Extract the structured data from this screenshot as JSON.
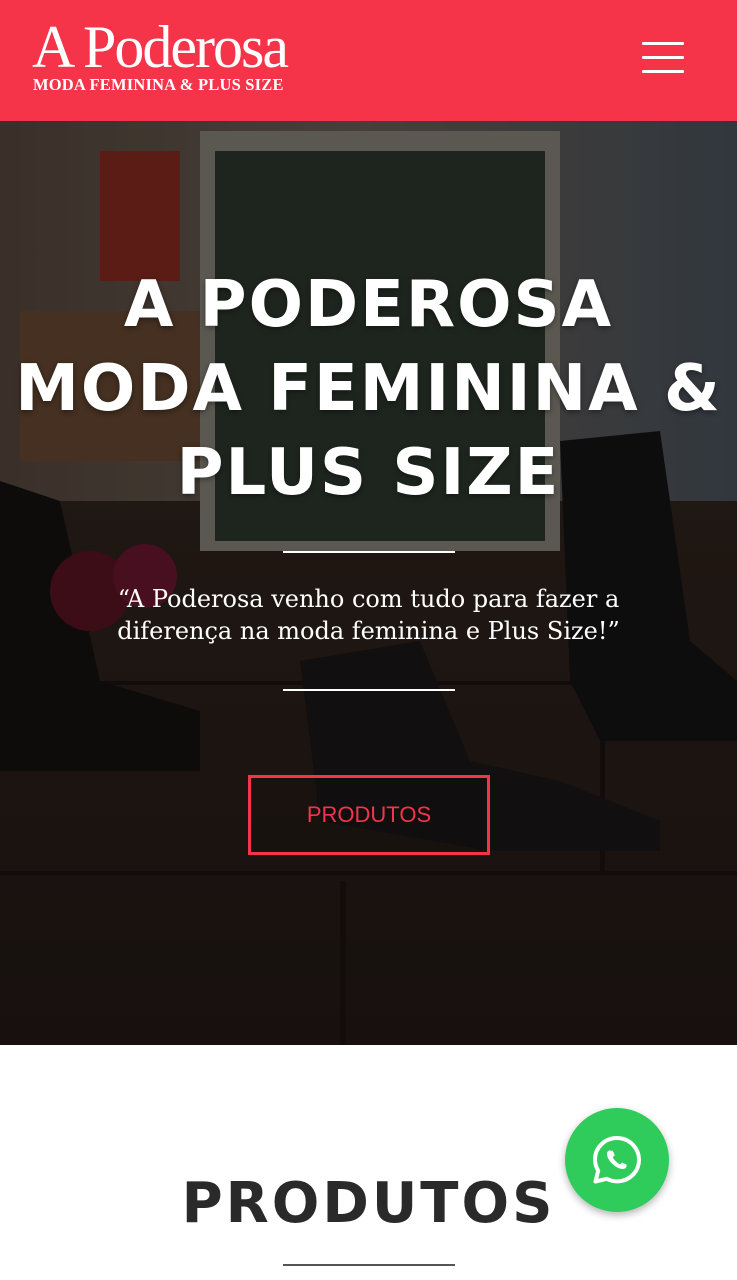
{
  "header": {
    "logo_title": "A Poderosa",
    "logo_subtitle": "MODA FEMININA & PLUS SIZE",
    "background_color": "#f5344a"
  },
  "hero": {
    "title_lines": [
      "A PODEROSA",
      "MODA FEMININA &",
      "PLUS SIZE"
    ],
    "quote": "“A Poderosa venho com tudo para fazer a diferença na moda feminina e Plus Size!”",
    "cta_label": "PRODUTOS",
    "accent_color": "#f5344a"
  },
  "products_section": {
    "title": "PRODUTOS"
  },
  "whatsapp": {
    "icon": "whatsapp-icon",
    "color": "#2fcc5b"
  }
}
